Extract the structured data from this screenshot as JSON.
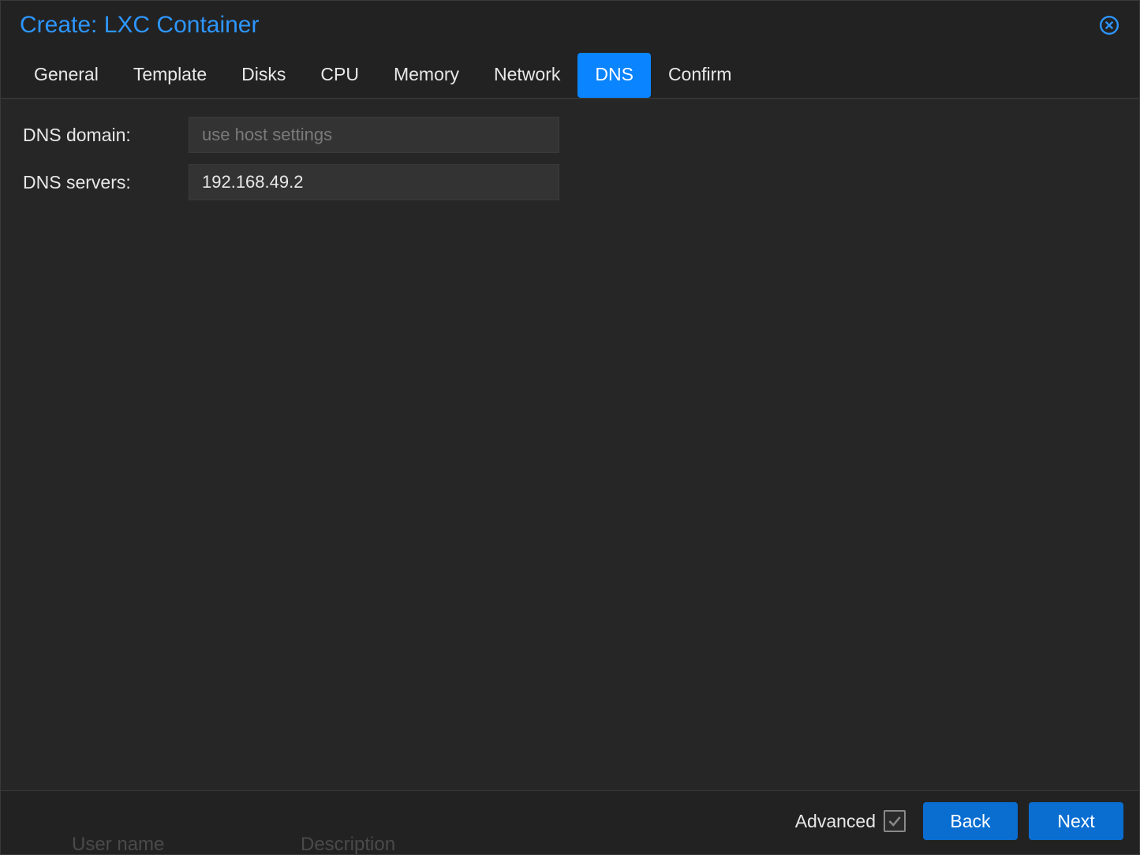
{
  "dialog": {
    "title": "Create: LXC Container"
  },
  "tabs": [
    {
      "label": "General",
      "active": false
    },
    {
      "label": "Template",
      "active": false
    },
    {
      "label": "Disks",
      "active": false
    },
    {
      "label": "CPU",
      "active": false
    },
    {
      "label": "Memory",
      "active": false
    },
    {
      "label": "Network",
      "active": false
    },
    {
      "label": "DNS",
      "active": true
    },
    {
      "label": "Confirm",
      "active": false
    }
  ],
  "form": {
    "dns_domain": {
      "label": "DNS domain:",
      "placeholder": "use host settings",
      "value": ""
    },
    "dns_servers": {
      "label": "DNS servers:",
      "value": "192.168.49.2"
    }
  },
  "footer": {
    "advanced_label": "Advanced",
    "advanced_checked": false,
    "back_label": "Back",
    "next_label": "Next"
  },
  "background": {
    "left": "User name",
    "right": "Description"
  }
}
